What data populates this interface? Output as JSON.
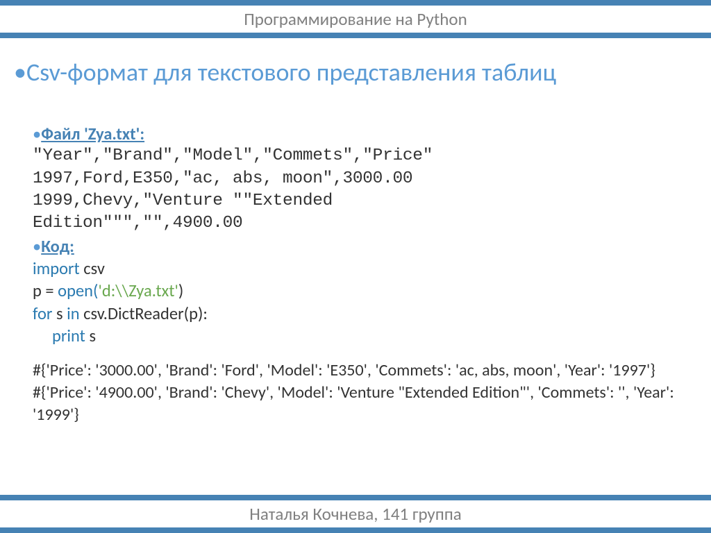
{
  "header": "Программирование на Python",
  "title": "Csv-формат для текстового представления таблиц",
  "bullet": "•",
  "file_label": "Файл 'Zya.txt':",
  "csv_line1": "\"Year\",\"Brand\",\"Model\",\"Commets\",\"Price\"",
  "csv_line2": "1997,Ford,E350,\"ac, abs, moon\",3000.00",
  "csv_line3": "1999,Chevy,\"Venture \"\"Extended",
  "csv_line4": "Edition\"\"\",\"\",4900.00",
  "code_label": "Код:",
  "code": {
    "import_kw": "import",
    "import_mod": "csv",
    "var_p": "p = ",
    "open_fn": "open(",
    "open_arg": "'d:\\\\Zya.txt'",
    "close_paren": ")",
    "for_kw": "for",
    "for_rest": " s ",
    "in_kw": "in ",
    "dictreader": "csv.DictReader",
    "dictreader_paren_open": "(",
    "dictreader_arg": "p",
    "dictreader_paren_close": "):",
    "print_kw": "print ",
    "print_arg": "s"
  },
  "output_line1": "#{'Price': '3000.00', 'Brand': 'Ford', 'Model': 'E350', 'Commets': 'ac, abs, moon', 'Year': '1997'}",
  "output_line2": "#{'Price': '4900.00', 'Brand': 'Chevy', 'Model': 'Venture \"Extended Edition\"', 'Commets': '', 'Year': '1999'}",
  "footer": "Наталья Кочнева, 141 группа"
}
